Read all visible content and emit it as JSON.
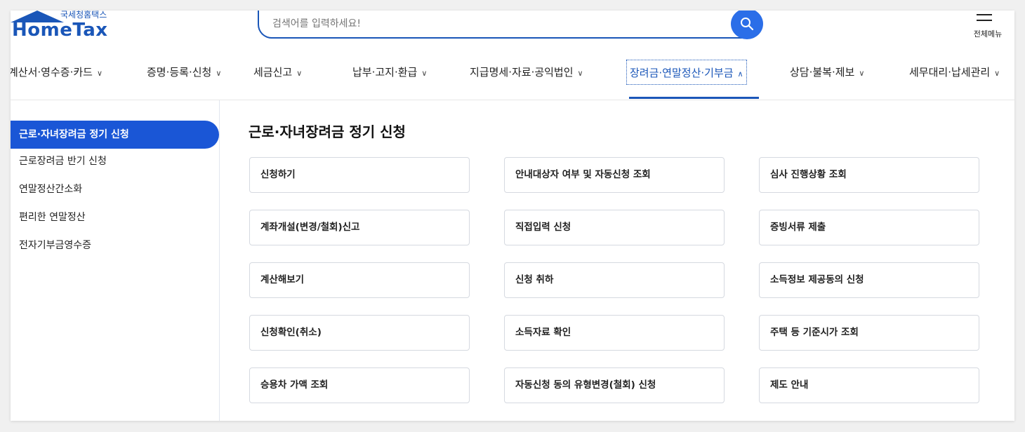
{
  "header": {
    "logo_sub": "국세청홈택스",
    "logo_main": "HomeTax",
    "search_placeholder": "검색어를 입력하세요!",
    "menu_all_label": "전체메뉴"
  },
  "nav": {
    "items": [
      {
        "label": "계산서·영수증·카드"
      },
      {
        "label": "증명·등록·신청"
      },
      {
        "label": "세금신고"
      },
      {
        "label": "납부·고지·환급"
      },
      {
        "label": "지급명세·자료·공익법인"
      },
      {
        "label": "장려금·연말정산·기부금",
        "active": true
      },
      {
        "label": "상담·불복·제보"
      },
      {
        "label": "세무대리·납세관리"
      }
    ],
    "chevron_down": "∨",
    "chevron_up": "∧"
  },
  "sidebar": {
    "items": [
      {
        "label": "근로·자녀장려금 정기 신청",
        "active": true
      },
      {
        "label": "근로장려금 반기 신청"
      },
      {
        "label": "연말정산간소화"
      },
      {
        "label": "편리한 연말정산"
      },
      {
        "label": "전자기부금영수증"
      }
    ]
  },
  "main": {
    "title": "근로·자녀장려금 정기 신청",
    "buttons": [
      "신청하기",
      "안내대상자 여부 및 자동신청 조회",
      "심사 진행상황 조회",
      "계좌개설(변경/철회)신고",
      "직접입력 신청",
      "증빙서류 제출",
      "계산해보기",
      "신청 취하",
      "소득정보 제공동의 신청",
      "신청확인(취소)",
      "소득자료 확인",
      "주택 등 기준시가 조회",
      "승용차 가액 조회",
      "자동신청 동의 유형변경(철회) 신청",
      "제도 안내"
    ]
  },
  "colors": {
    "brand": "#1a56b8",
    "sidebar_active": "#1a56d6",
    "search_button": "#2b6ee8"
  }
}
